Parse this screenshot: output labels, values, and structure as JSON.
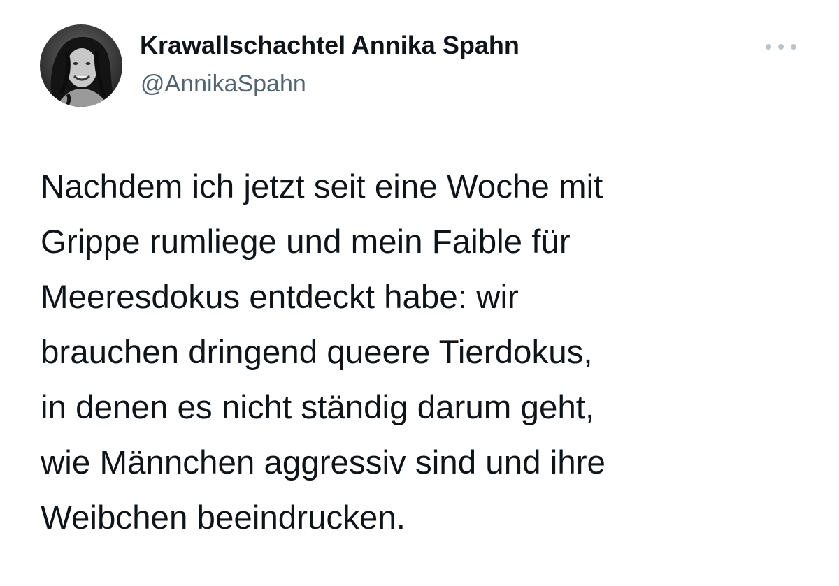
{
  "author": {
    "display_name": "Krawallschachtel Annika Spahn",
    "handle": "@AnnikaSpahn",
    "avatar_icon": "profile-photo-avatar"
  },
  "actions": {
    "more_icon": "more-options-icon"
  },
  "tweet": {
    "lines": [
      "Nachdem ich jetzt seit eine Woche mit",
      "Grippe rumliege und mein Faible für",
      "Meeresdokus entdeckt habe: wir",
      "brauchen dringend queere Tierdokus,",
      "in denen es nicht ständig darum geht,",
      "wie Männchen aggressiv sind und ihre",
      "Weibchen beeindrucken."
    ]
  },
  "colors": {
    "text_primary": "#0f1419",
    "text_secondary": "#536471",
    "more_dots": "#b9c2ca",
    "background": "#ffffff"
  }
}
